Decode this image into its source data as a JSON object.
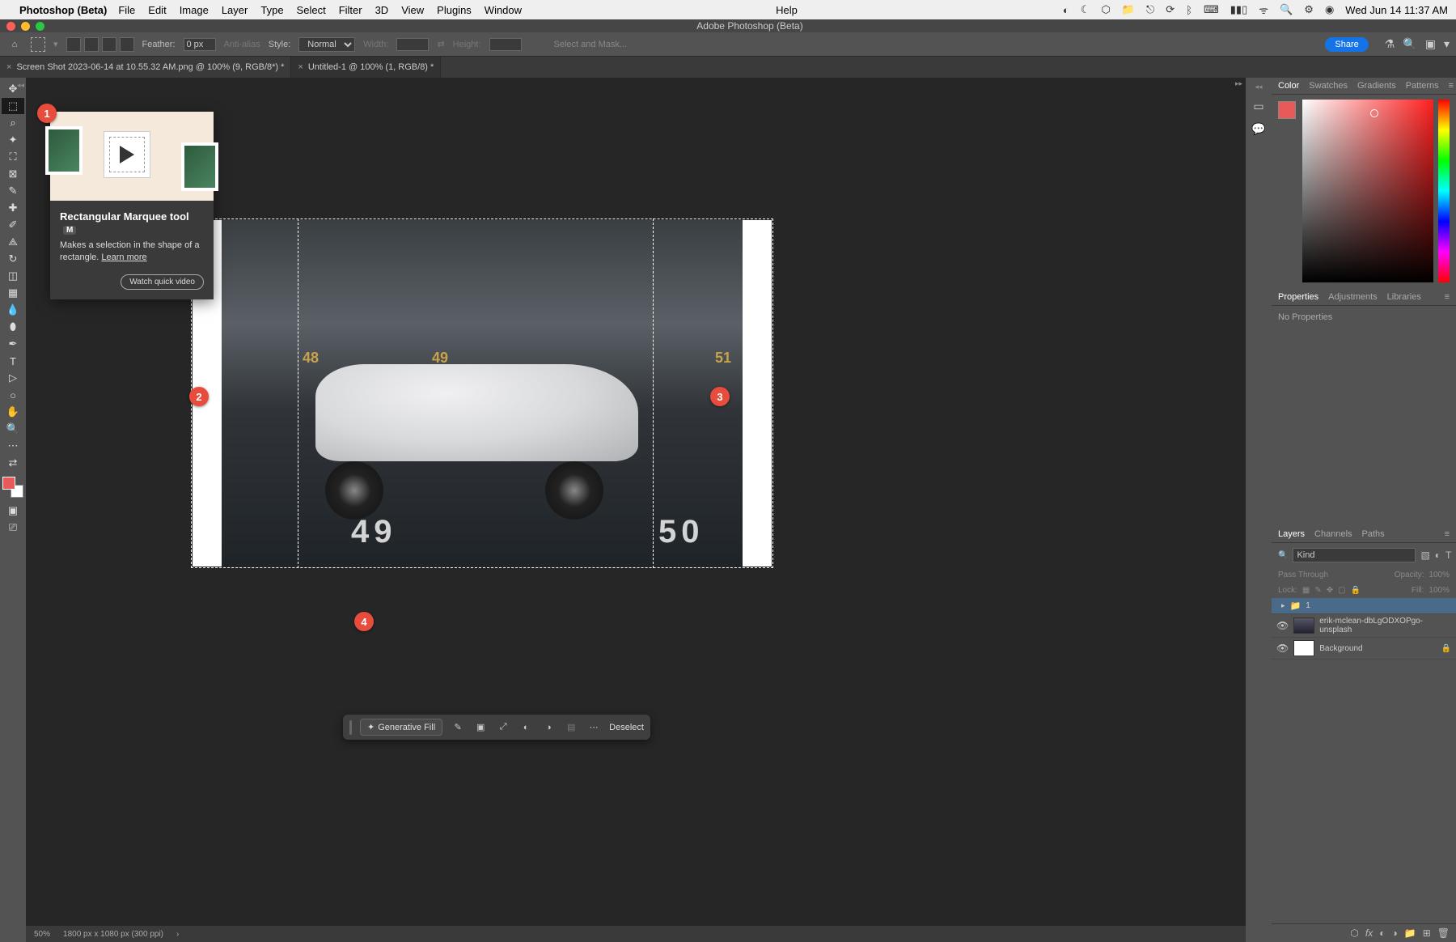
{
  "mac_menu": {
    "app": "Photoshop (Beta)",
    "items": [
      "File",
      "Edit",
      "Image",
      "Layer",
      "Type",
      "Select",
      "Filter",
      "3D",
      "View",
      "Plugins",
      "Window"
    ],
    "help": "Help",
    "datetime": "Wed Jun 14  11:37 AM"
  },
  "window_title": "Adobe Photoshop (Beta)",
  "options": {
    "feather_label": "Feather:",
    "feather_value": "0 px",
    "antialias": "Anti-alias",
    "style_label": "Style:",
    "style_value": "Normal",
    "width_label": "Width:",
    "height_label": "Height:",
    "select_mask": "Select and Mask...",
    "share": "Share"
  },
  "tabs": [
    {
      "label": "Screen Shot 2023-06-14 at 10.55.32 AM.png @ 100% (9, RGB/8*) *",
      "active": false
    },
    {
      "label": "Untitled-1 @ 100% (1, RGB/8) *",
      "active": true
    }
  ],
  "tooltip": {
    "title": "Rectangular Marquee tool",
    "shortcut": "M",
    "desc": "Makes a selection in the shape of a rectangle.",
    "learn": "Learn more",
    "watch": "Watch quick video"
  },
  "ctx_bar": {
    "gen_fill": "Generative Fill",
    "deselect": "Deselect"
  },
  "panels": {
    "color_tabs": [
      "Color",
      "Swatches",
      "Gradients",
      "Patterns"
    ],
    "props_tabs": [
      "Properties",
      "Adjustments",
      "Libraries"
    ],
    "no_props": "No Properties",
    "layers_tabs": [
      "Layers",
      "Channels",
      "Paths"
    ],
    "layer_kind": "Kind",
    "blend_mode": "Pass Through",
    "opacity_label": "Opacity:",
    "opacity_value": "100%",
    "lock_label": "Lock:",
    "fill_label": "Fill:",
    "fill_value": "100%",
    "layers": [
      {
        "name": "1",
        "group": true,
        "sel": true
      },
      {
        "name": "erik-mclean-dbLgODXOPgo-unsplash",
        "sel": false
      },
      {
        "name": "Background",
        "locked": true
      }
    ]
  },
  "canvas": {
    "wall_nums": [
      "48",
      "49",
      "51"
    ],
    "parking_nums": [
      "49",
      "50"
    ]
  },
  "annotations": {
    "b1": "1",
    "b2": "2",
    "b3": "3",
    "b4": "4"
  },
  "status": {
    "zoom": "50%",
    "dims": "1800 px x 1080 px (300 ppi)"
  }
}
